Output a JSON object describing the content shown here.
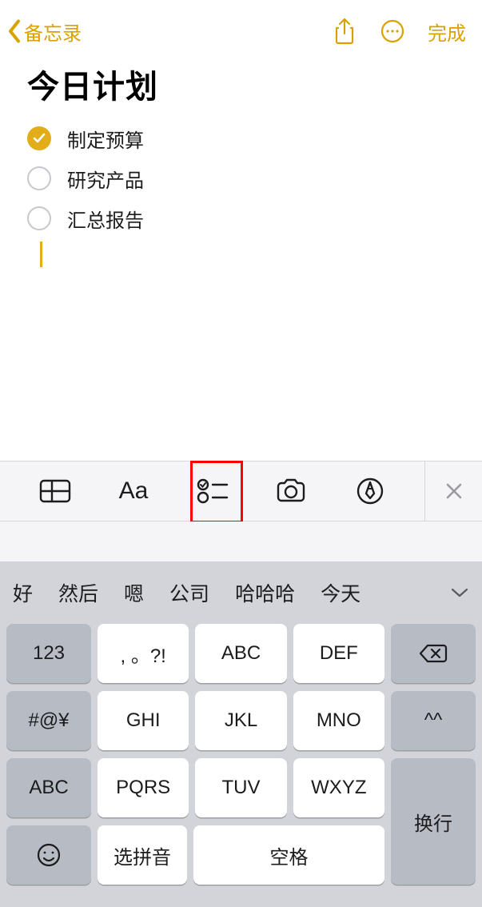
{
  "nav": {
    "back_label": "备忘录",
    "done_label": "完成"
  },
  "note": {
    "title": "今日计划",
    "items": [
      {
        "text": "制定预算",
        "checked": true
      },
      {
        "text": "研究产品",
        "checked": false
      },
      {
        "text": "汇总报告",
        "checked": false
      }
    ]
  },
  "toolbar": {
    "aa_label": "Aa"
  },
  "keyboard": {
    "suggestions": [
      "好",
      "然后",
      "嗯",
      "公司",
      "哈哈哈",
      "今天"
    ],
    "rows": [
      [
        "123",
        ", 。?!",
        "ABC",
        "DEF"
      ],
      [
        "#@¥",
        "GHI",
        "JKL",
        "MNO",
        "^^"
      ],
      [
        "ABC",
        "PQRS",
        "TUV",
        "WXYZ"
      ]
    ],
    "bottom": {
      "select_pinyin": "选拼音",
      "space": "空格",
      "enter": "换行"
    }
  }
}
